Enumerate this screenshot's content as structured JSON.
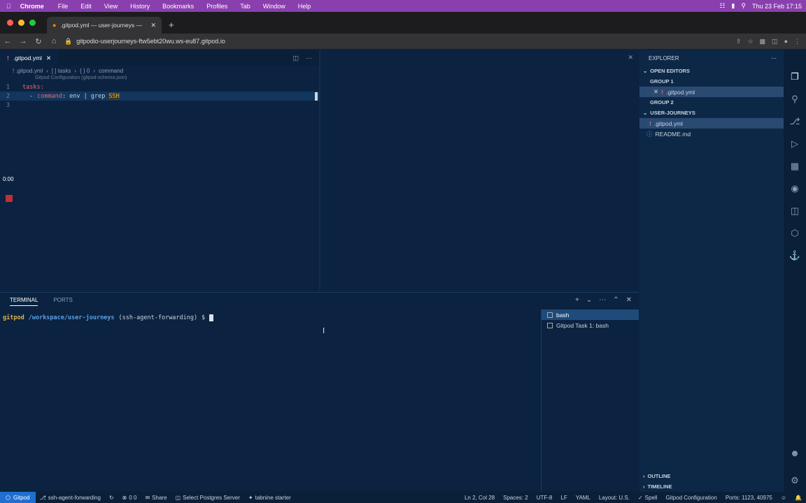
{
  "menubar": {
    "app": "Chrome",
    "items": [
      "File",
      "Edit",
      "View",
      "History",
      "Bookmarks",
      "Profiles",
      "Tab",
      "Window",
      "Help"
    ],
    "clock": "Thu 23 Feb  17:15"
  },
  "browser": {
    "tab_title": ".gitpod.yml — user-journeys —",
    "url": "gitpodio-userjourneys-ftw5ebt20wu.ws-eu87.gitpod.io"
  },
  "editor": {
    "tab": ".gitpod.yml",
    "breadcrumb": [
      "! .gitpod.yml",
      "[ ] tasks",
      "{ } 0",
      "command"
    ],
    "schema_hint": "Gitpod Configuration (gitpod-schema.json)",
    "lines": [
      {
        "n": "1",
        "text": "tasks:"
      },
      {
        "n": "2",
        "dash": "-",
        "key": "command",
        "rest": ": env | grep",
        "hl": "SSH"
      },
      {
        "n": "3",
        "text": ""
      }
    ],
    "rec_time": "0:00"
  },
  "panel": {
    "tabs": [
      "TERMINAL",
      "PORTS"
    ],
    "prompt": {
      "user": "gitpod",
      "path": "/workspace/user-journeys",
      "branch": "(ssh-agent-forwarding)",
      "symbol": "$"
    },
    "terminals": [
      "bash",
      "Gitpod Task 1: bash"
    ]
  },
  "explorer": {
    "title": "EXPLORER",
    "open_editors": "OPEN EDITORS",
    "group1": "GROUP 1",
    "group1_file": ".gitpod.yml",
    "group2": "GROUP 2",
    "folder": "USER-JOURNEYS",
    "files": [
      ".gitpod.yml",
      "README.md"
    ],
    "outline": "OUTLINE",
    "timeline": "TIMELINE"
  },
  "status": {
    "remote": "Gitpod",
    "branch": "ssh-agent-forwarding",
    "problems": "0  0",
    "share": "Share",
    "postgres": "Select Postgres Server",
    "tabnine": "tabnine starter",
    "position": "Ln 2, Col 28",
    "spaces": "Spaces: 2",
    "encoding": "UTF-8",
    "eol": "LF",
    "lang": "YAML",
    "layout": "Layout: U.S.",
    "spell": "Spell",
    "config": "Gitpod Configuration",
    "ports": "Ports: 1123, 40975"
  },
  "colors": {
    "accent": "#1f6fd0",
    "editor_bg": "#0b2340",
    "yaml_key": "#e06c75",
    "menubar": "#8a3fae"
  }
}
